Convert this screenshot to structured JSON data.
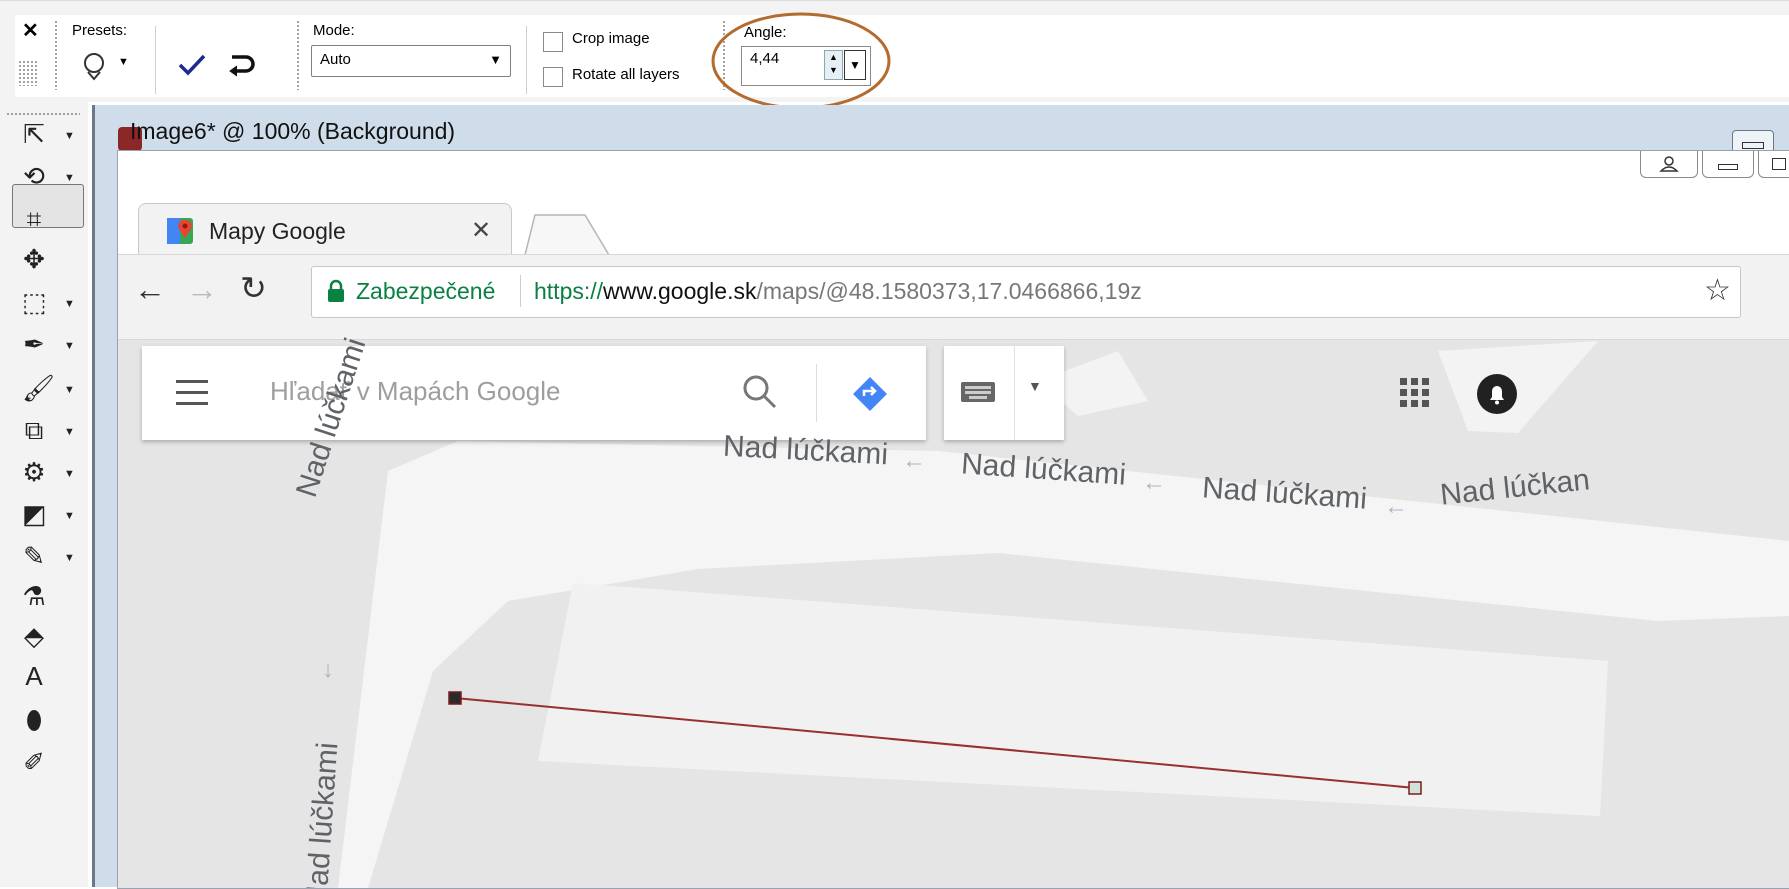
{
  "options_bar": {
    "close_glyph": "✕",
    "presets_label": "Presets:",
    "mode_label": "Mode:",
    "mode_value": "Auto",
    "crop_image_label": "Crop image",
    "rotate_layers_label": "Rotate all layers",
    "angle_label": "Angle:",
    "angle_value": "4,44",
    "highlight_color": "#b36b2e"
  },
  "tools": [
    {
      "name": "pick-tool-icon",
      "glyph": "⇱"
    },
    {
      "name": "straighten-tool-icon",
      "glyph": "⟲"
    },
    {
      "name": "crop-tool-icon",
      "glyph": "⌗"
    },
    {
      "name": "move-tool-icon",
      "glyph": "✥"
    },
    {
      "name": "selection-tool-icon",
      "glyph": "⬚"
    },
    {
      "name": "dropper-tool-icon",
      "glyph": "✒"
    },
    {
      "name": "paint-brush-icon",
      "glyph": "🖌"
    },
    {
      "name": "clone-tool-icon",
      "glyph": "⧉"
    },
    {
      "name": "retouch-tool-icon",
      "glyph": "⚙"
    },
    {
      "name": "dodge-burn-icon",
      "glyph": "◩"
    },
    {
      "name": "eraser-tool-icon",
      "glyph": "✎"
    },
    {
      "name": "brush-variance-icon",
      "glyph": "⚗"
    },
    {
      "name": "fill-tool-icon",
      "glyph": "⬘"
    },
    {
      "name": "text-tool-icon",
      "glyph": "A"
    },
    {
      "name": "shape-tool-icon",
      "glyph": "⬮"
    },
    {
      "name": "pen-tool-icon",
      "glyph": "✐"
    }
  ],
  "image_window": {
    "title": "Image6* @ 100% (Background)"
  },
  "browser": {
    "tab_title": "Mapy Google",
    "secure_label": "Zabezpečené",
    "url_scheme": "https://",
    "url_host": "www.google.sk",
    "url_path": "/maps/@48.1580373,17.0466866,19z",
    "secure_color": "#0b8043",
    "search_placeholder": "Hľadať v Mapách Google",
    "directions_color": "#4285f4"
  },
  "map": {
    "street_name": "Nad lúčkami",
    "street_label_left": "Nad lúčkami",
    "street_label_top1": "Nad lúčkami",
    "street_label_top2": "Nad lúčkami",
    "street_label_top3": "Nad lúčkami",
    "street_label_top4": "Nad lúčkan",
    "street_label_left2": "Nad lúčkami"
  }
}
